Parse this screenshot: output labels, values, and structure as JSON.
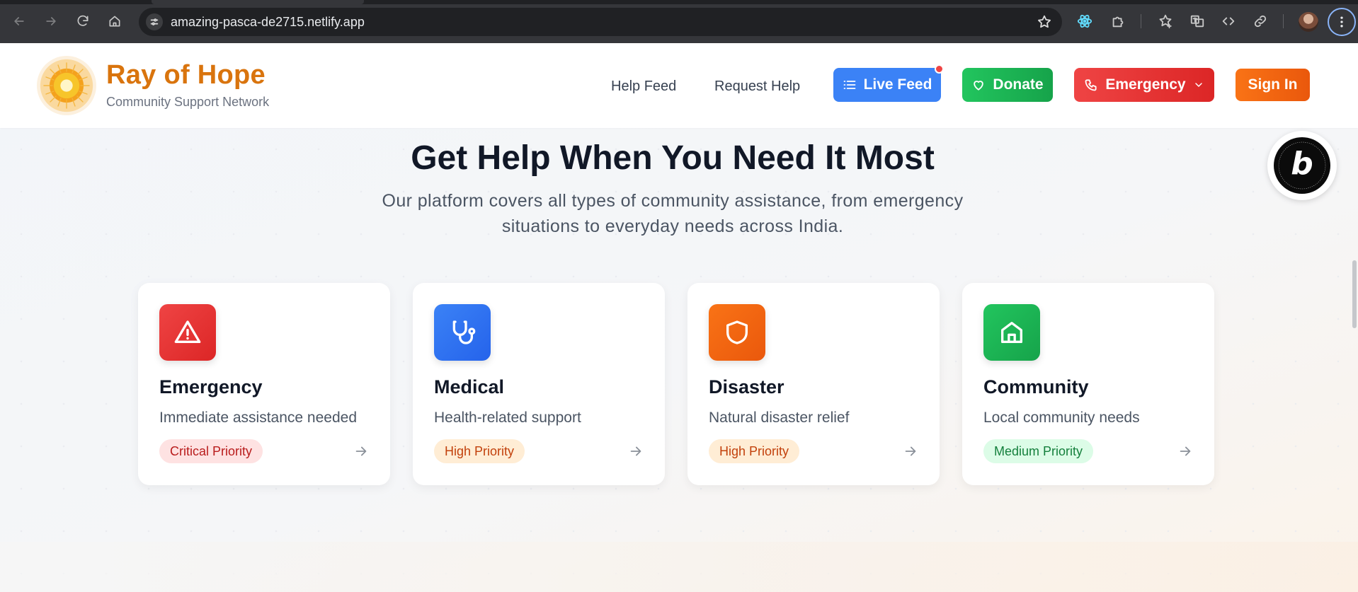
{
  "browser": {
    "url": "amazing-pasca-de2715.netlify.app",
    "icons": [
      "back-icon",
      "forward-icon",
      "reload-icon",
      "home-icon",
      "site-info-icon",
      "bookmark-star-icon",
      "react-devtools-icon",
      "extensions-icon",
      "reading-list-icon",
      "translate-icon",
      "code-icon",
      "link-icon",
      "profile-avatar",
      "more-menu-icon"
    ]
  },
  "header": {
    "brand_title": "Ray of Hope",
    "brand_subtitle": "Community Support Network",
    "nav": {
      "help_feed": "Help Feed",
      "request_help": "Request Help"
    },
    "buttons": {
      "live_feed": "Live Feed",
      "donate": "Donate",
      "emergency": "Emergency",
      "sign_in": "Sign In"
    }
  },
  "hero": {
    "title": "Get Help When You Need It Most",
    "subtitle": "Our platform covers all types of community assistance, from emergency situations to everyday needs across India."
  },
  "categories": [
    {
      "title": "Emergency",
      "description": "Immediate assistance needed",
      "priority": "Critical Priority",
      "icon": "alert-triangle-icon",
      "color": "#ef4444",
      "badge_bg": "#fee2e2",
      "badge_fg": "#b91c1c"
    },
    {
      "title": "Medical",
      "description": "Health-related support",
      "priority": "High Priority",
      "icon": "stethoscope-icon",
      "color": "#3b82f6",
      "badge_bg": "#ffedd5",
      "badge_fg": "#c2410c"
    },
    {
      "title": "Disaster",
      "description": "Natural disaster relief",
      "priority": "High Priority",
      "icon": "shield-icon",
      "color": "#f97316",
      "badge_bg": "#ffedd5",
      "badge_fg": "#c2410c"
    },
    {
      "title": "Community",
      "description": "Local community needs",
      "priority": "Medium Priority",
      "icon": "home-icon",
      "color": "#22c55e",
      "badge_bg": "#dcfce7",
      "badge_fg": "#15803d"
    }
  ],
  "colors": {
    "brand_orange": "#d9740d",
    "live_feed_blue": "#3b82f6",
    "donate_green": "#22c55e",
    "emergency_red": "#ef4444",
    "sign_in_orange": "#f97316"
  }
}
